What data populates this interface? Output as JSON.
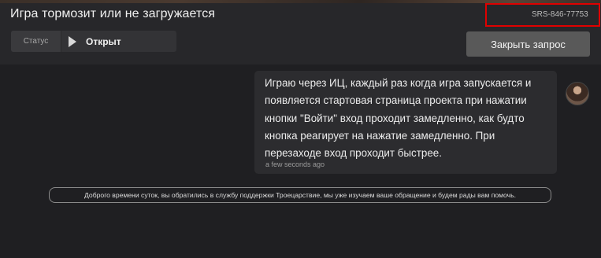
{
  "ticket": {
    "title": "Игра тормозит или не загружается",
    "id": "SRS-846-77753"
  },
  "status": {
    "label": "Статус",
    "value": "Открыт"
  },
  "actions": {
    "close_label": "Закрыть запрос"
  },
  "messages": [
    {
      "text": "Играю через ИЦ, каждый раз когда игра запускается и появляется стартовая страница проекта при нажатии кнопки \"Войти\" вход проходит замедленно, как будто кнопка реагирует на нажатие замедленно. При перезаходе вход проходит быстрее.",
      "time": "a few seconds ago"
    }
  ],
  "system_notice": "Доброго времени суток, вы обратились в службу поддержки Троецарствие, мы уже изучаем ваше обращение и будем рады вам помочь.",
  "colors": {
    "background": "#1f1f22",
    "header": "#27272a",
    "highlight_box": "#e00000",
    "button": "#595959"
  },
  "icons": {
    "status": "play-icon",
    "user": "avatar"
  }
}
